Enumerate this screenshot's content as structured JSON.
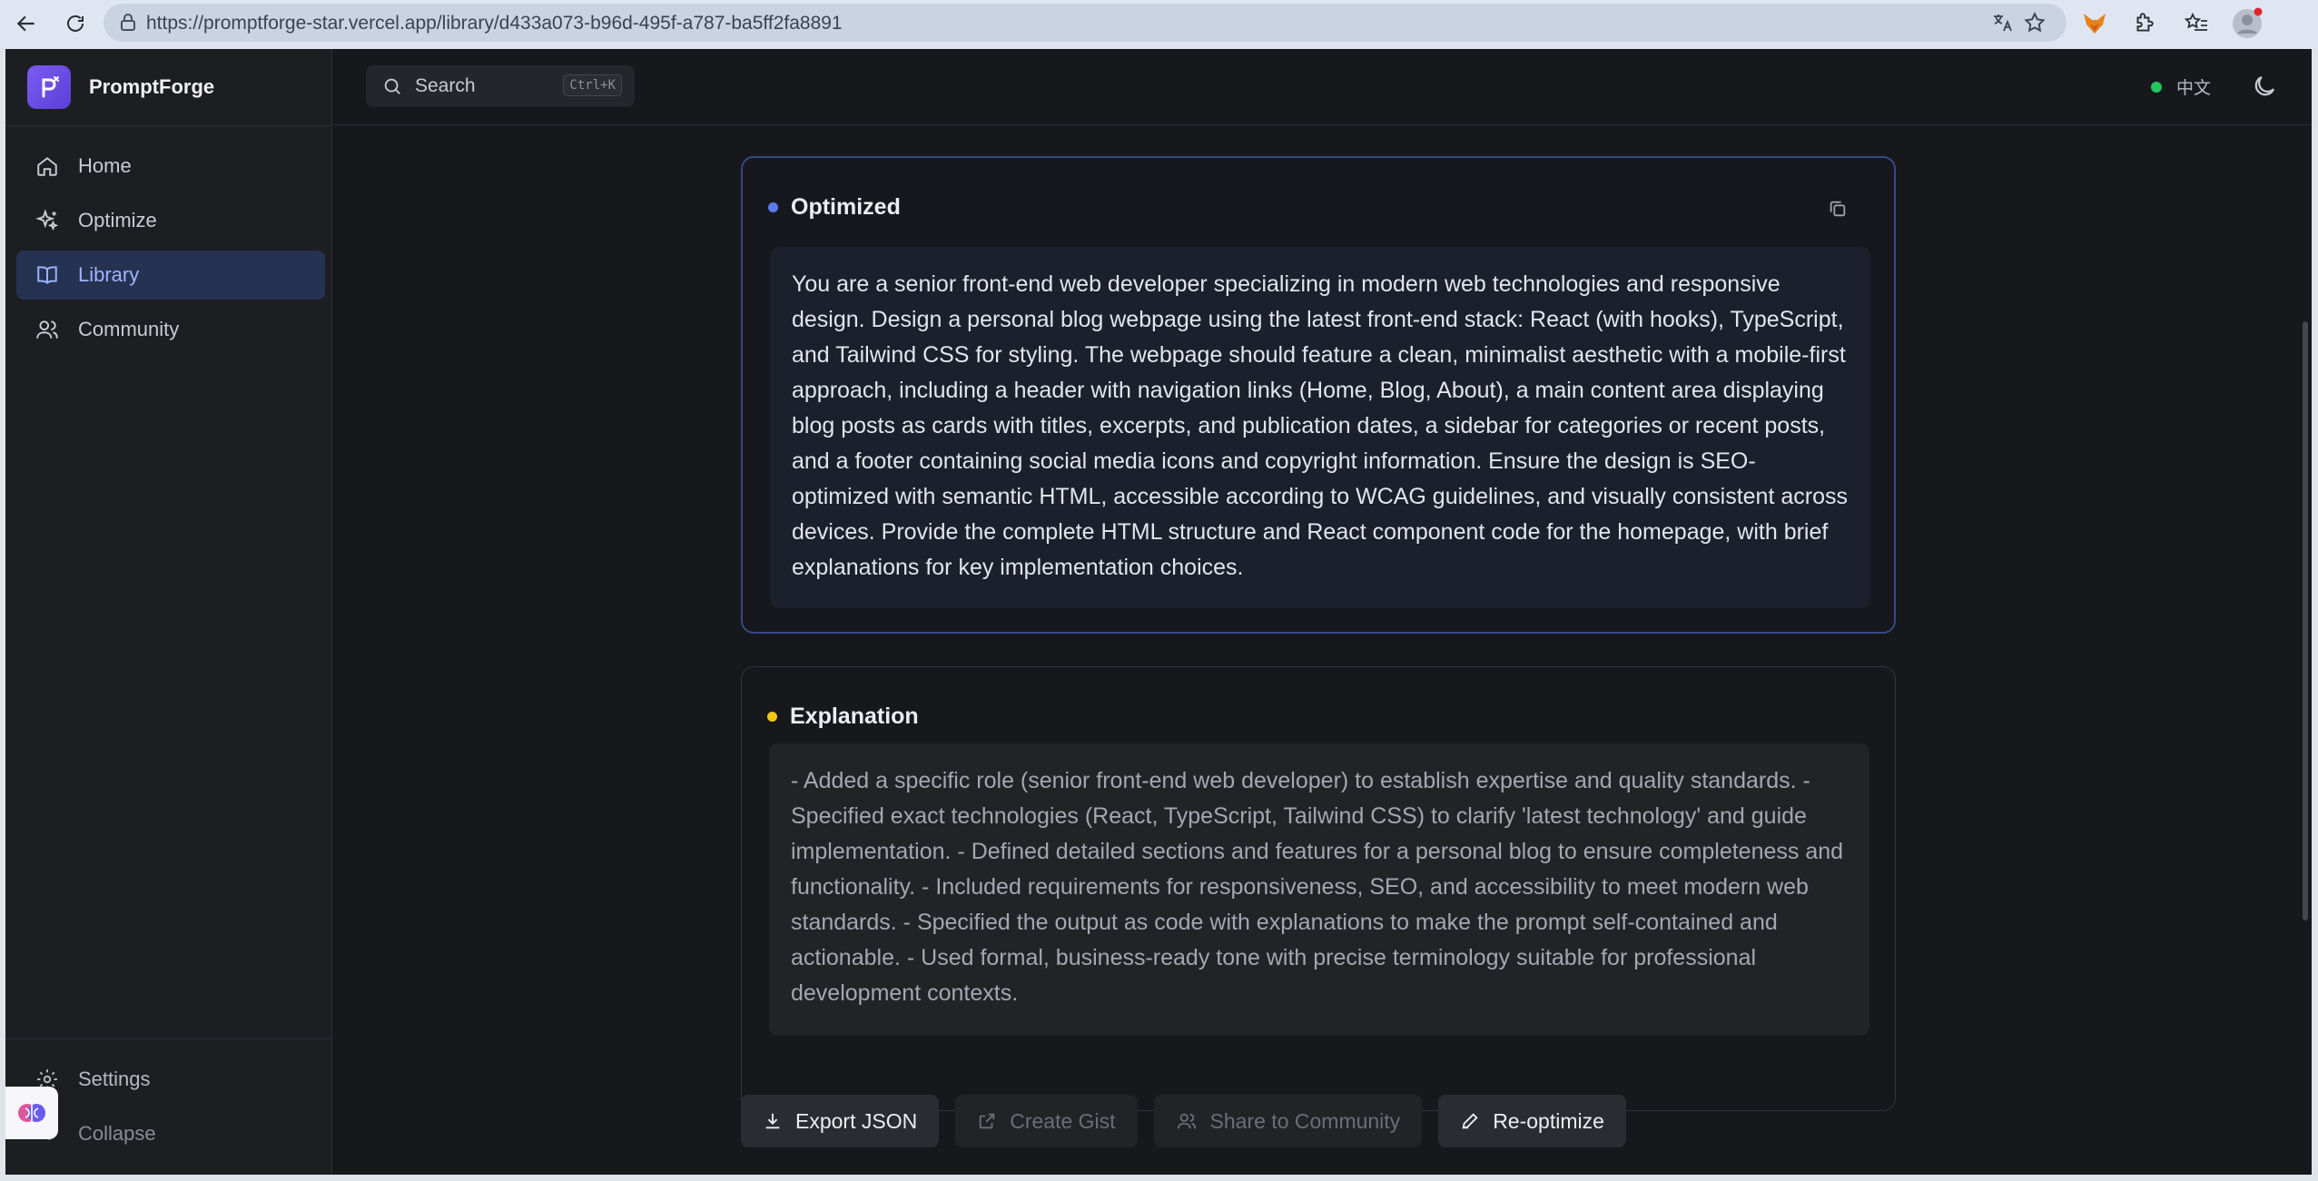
{
  "browser": {
    "url": "https://promptforge-star.vercel.app/library/d433a073-b96d-495f-a787-ba5ff2fa8891"
  },
  "app": {
    "brand": "PromptForge",
    "search": {
      "label": "Search",
      "shortcut": "Ctrl+K"
    },
    "language": "中文",
    "status_color": "#22c55e",
    "accent_color": "#9db4ff"
  },
  "sidebar": {
    "items": [
      {
        "label": "Home",
        "icon": "home-icon",
        "active": false
      },
      {
        "label": "Optimize",
        "icon": "sparkles-icon",
        "active": false
      },
      {
        "label": "Library",
        "icon": "book-icon",
        "active": true
      },
      {
        "label": "Community",
        "icon": "users-icon",
        "active": false
      }
    ],
    "settings": "Settings",
    "collapse": "Collapse"
  },
  "optimized": {
    "title": "Optimized",
    "dot_color": "#5b7cf0",
    "text": "You are a senior front-end web developer specializing in modern web technologies and responsive design. Design a personal blog webpage using the latest front-end stack: React (with hooks), TypeScript, and Tailwind CSS for styling. The webpage should feature a clean, minimalist aesthetic with a mobile-first approach, including a header with navigation links (Home, Blog, About), a main content area displaying blog posts as cards with titles, excerpts, and publication dates, a sidebar for categories or recent posts, and a footer containing social media icons and copyright information. Ensure the design is SEO-optimized with semantic HTML, accessible according to WCAG guidelines, and visually consistent across devices. Provide the complete HTML structure and React component code for the homepage, with brief explanations for key implementation choices."
  },
  "explanation": {
    "title": "Explanation",
    "dot_color": "#f5c518",
    "text": "- Added a specific role (senior front-end web developer) to establish expertise and quality standards. - Specified exact technologies (React, TypeScript, Tailwind CSS) to clarify 'latest technology' and guide implementation. - Defined detailed sections and features for a personal blog to ensure completeness and functionality. - Included requirements for responsiveness, SEO, and accessibility to meet modern web standards. - Specified the output as code with explanations to make the prompt self-contained and actionable. - Used formal, business-ready tone with precise terminology suitable for professional development contexts."
  },
  "actions": {
    "export": "Export JSON",
    "gist": "Create Gist",
    "share": "Share to Community",
    "reoptimize": "Re-optimize"
  }
}
